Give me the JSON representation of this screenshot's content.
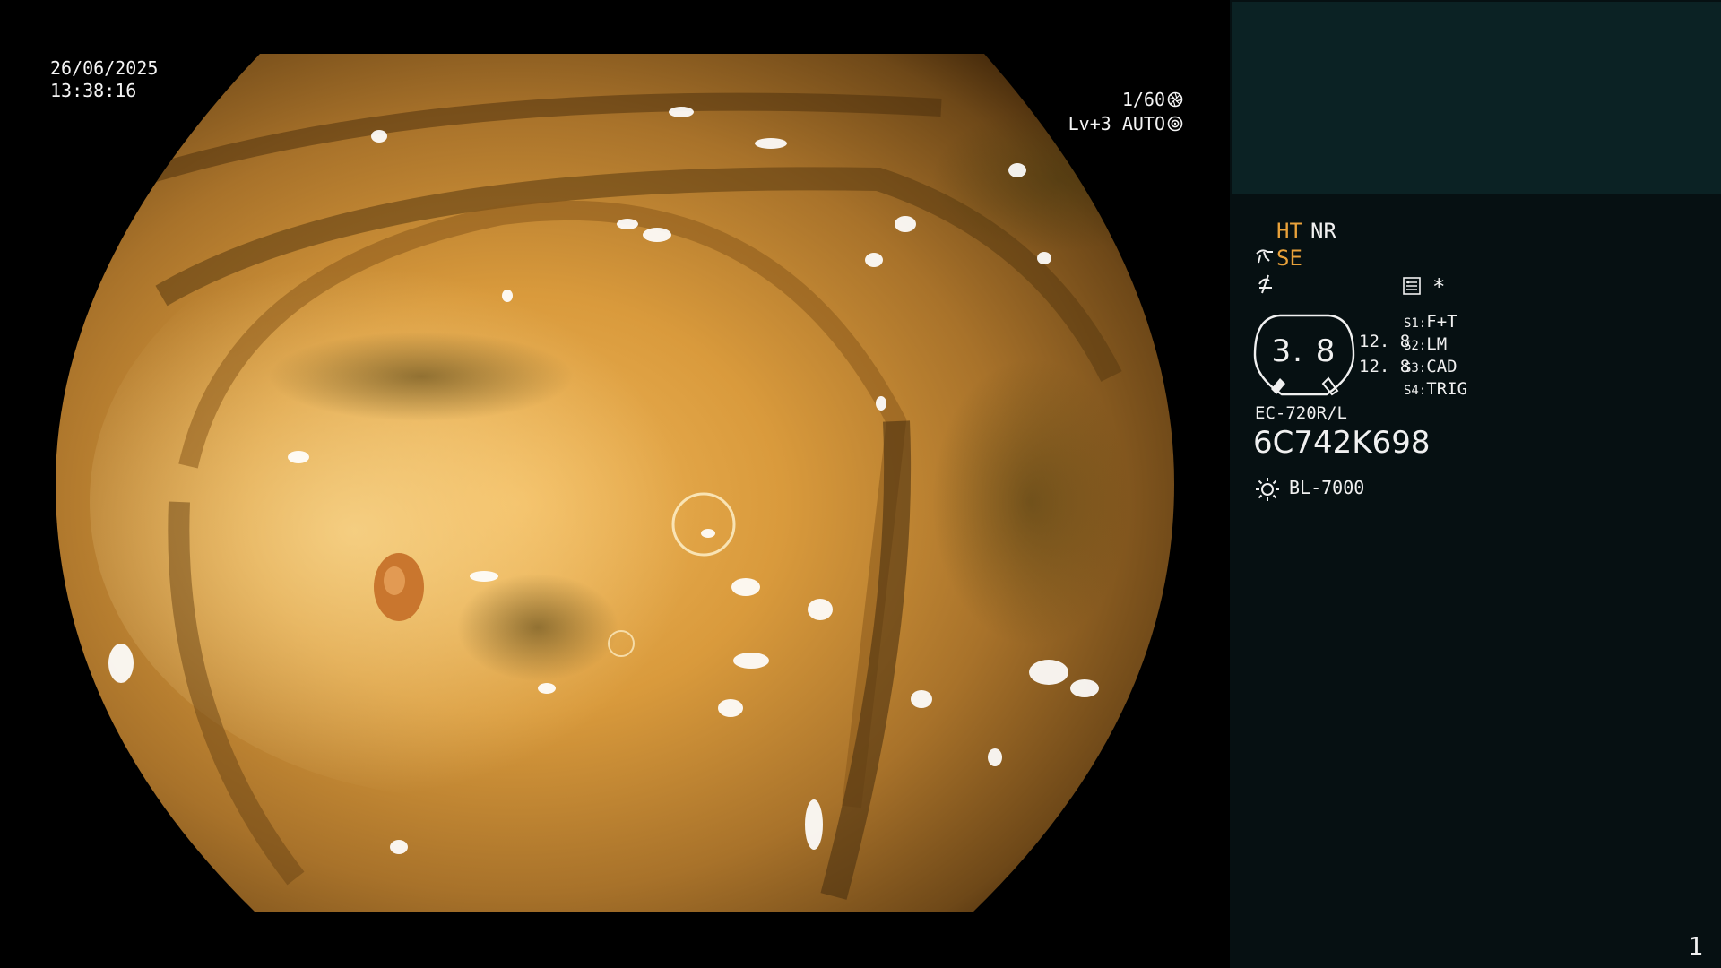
{
  "overlay": {
    "date": "26/06/2025",
    "time": "13:38:16",
    "shutter": "1/60",
    "shutter_icon": "aperture-icon",
    "exposure": "Lv+3 AUTO",
    "exposure_icon": "auto-iris-icon"
  },
  "panel": {
    "ht": "HT",
    "nr": "NR",
    "se": "SE",
    "se_icon": "hand-pointer-icon",
    "freeze_icon": "freeze-icon",
    "record_icon": "record-icon",
    "star": "*",
    "zoom": {
      "value": "3. 8",
      "top": "12. 8",
      "bottom": "12. 8",
      "icon": "zoom-gauge-icon"
    },
    "switches": [
      {
        "key": "S1:",
        "value": "F+T"
      },
      {
        "key": "S2:",
        "value": "LM"
      },
      {
        "key": "S3:",
        "value": "CAD"
      },
      {
        "key": "S4:",
        "value": "TRIG"
      }
    ],
    "scope_model": "EC-720R/L",
    "serial": "6C742K698",
    "light_icon": "light-source-icon",
    "light_source": "BL-7000",
    "page_number": "1"
  },
  "colors": {
    "panel_bg": "#061012",
    "header_bg": "#0b2224",
    "accent_orange": "#e8a13a",
    "text": "#f0f0f0"
  }
}
